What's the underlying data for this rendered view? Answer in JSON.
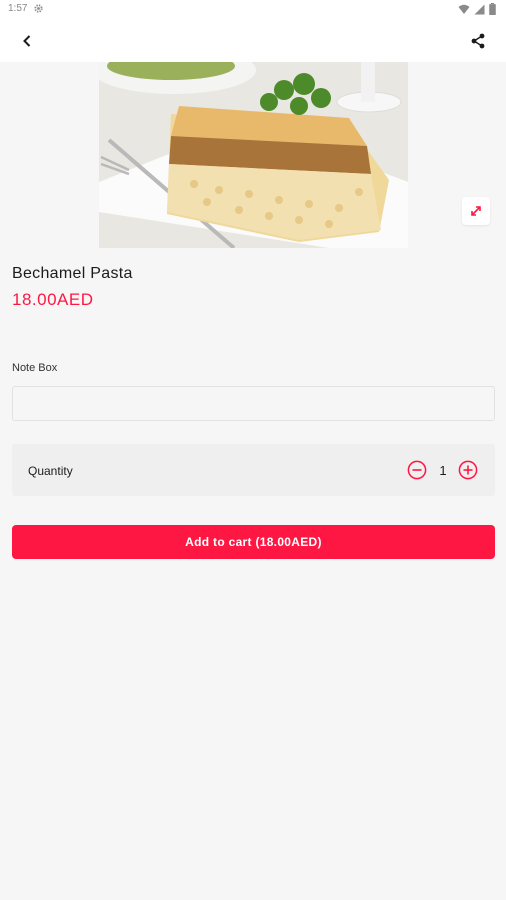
{
  "status_bar": {
    "time": "1:57",
    "icons": [
      "settings-icon",
      "wifi-icon",
      "signal-icon",
      "battery-icon"
    ]
  },
  "app_bar": {
    "back_icon": "chevron-left-icon",
    "share_icon": "share-icon"
  },
  "product": {
    "image": "bechamel-pasta-photo",
    "expand_icon": "expand-diagonal-icon",
    "name": "Bechamel Pasta",
    "price": "18.00AED"
  },
  "note": {
    "label": "Note Box",
    "value": "",
    "placeholder": ""
  },
  "quantity": {
    "label": "Quantity",
    "value": "1",
    "minus_icon": "minus-circle-icon",
    "plus_icon": "plus-circle-icon"
  },
  "cart": {
    "button_label": "Add to cart (18.00AED)"
  },
  "colors": {
    "accent": "#ff1744",
    "background": "#f6f6f6",
    "surface": "#ffffff"
  }
}
